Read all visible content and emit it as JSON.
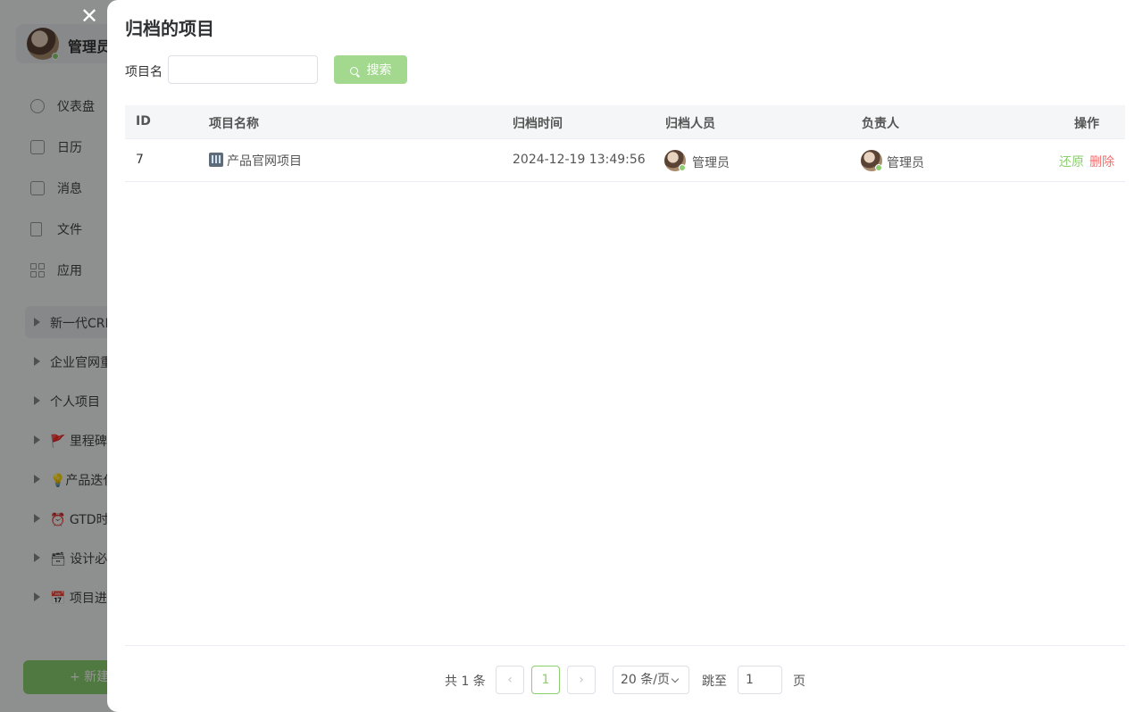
{
  "sidebar": {
    "user_name": "管理员",
    "nav": [
      {
        "label": "仪表盘",
        "icon": "dashboard-icon"
      },
      {
        "label": "日历",
        "icon": "calendar-icon"
      },
      {
        "label": "消息",
        "icon": "message-icon"
      },
      {
        "label": "文件",
        "icon": "file-icon"
      },
      {
        "label": "应用",
        "icon": "apps-icon"
      }
    ],
    "projects": [
      {
        "label": "新一代CRI"
      },
      {
        "label": "企业官网重"
      },
      {
        "label": "个人项目"
      },
      {
        "label": "🚩 里程碑"
      },
      {
        "label": "💡产品迭代"
      },
      {
        "label": "⏰ GTD时"
      },
      {
        "label": "🗃 设计必"
      },
      {
        "label": "📅 项目进"
      }
    ],
    "new_button": "+ 新建"
  },
  "drawer": {
    "close_icon": "close-icon",
    "title": "归档的项目",
    "filter": {
      "label": "项目名",
      "placeholder": "",
      "value": "",
      "search_button": "搜索"
    },
    "table": {
      "columns": [
        "ID",
        "项目名称",
        "归档时间",
        "归档人员",
        "负责人",
        "操作"
      ],
      "rows": [
        {
          "id": "7",
          "name": "产品官网项目",
          "archived_at": "2024-12-19 13:49:56",
          "archived_by": "管理员",
          "owner": "管理员",
          "actions": {
            "restore": "还原",
            "delete": "删除"
          }
        }
      ]
    },
    "pagination": {
      "total": "共 1 条",
      "prev": "‹",
      "current_page": "1",
      "next": "›",
      "page_size": "20 条/页",
      "jump_label": "跳至",
      "jump_value": "1",
      "page_suffix": "页"
    }
  },
  "colors": {
    "accent": "#8bcf70",
    "danger": "#f56c6c"
  }
}
